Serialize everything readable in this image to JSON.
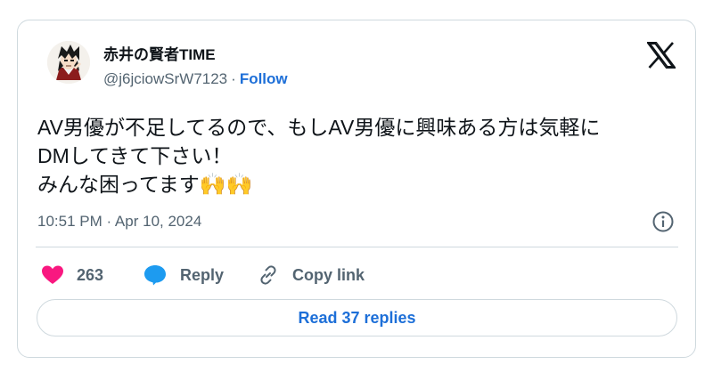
{
  "author": {
    "display_name": "赤井の賢者TIME",
    "handle": "@j6jciowSrW7123",
    "separator": "·",
    "follow_label": "Follow",
    "avatar_icon": "anime-character-avatar"
  },
  "brand": {
    "logo_icon": "x-logo-icon"
  },
  "tweet": {
    "text_line1": "AV男優が不足してるので、もしAV男優に興味ある方は気軽に",
    "text_line2": "DMしてきて下さい！",
    "text_line3": "みんな困ってます",
    "emoji": "🙌🙌",
    "timestamp": "10:51 PM · Apr 10, 2024"
  },
  "actions": {
    "like_count": "263",
    "reply_label": "Reply",
    "copy_label": "Copy link",
    "read_replies_label": "Read 37 replies"
  },
  "colors": {
    "link": "#1d6fd8",
    "heart": "#f91880",
    "reply_bubble": "#1d9bf0",
    "muted": "#536471",
    "border": "#cfd9de"
  }
}
